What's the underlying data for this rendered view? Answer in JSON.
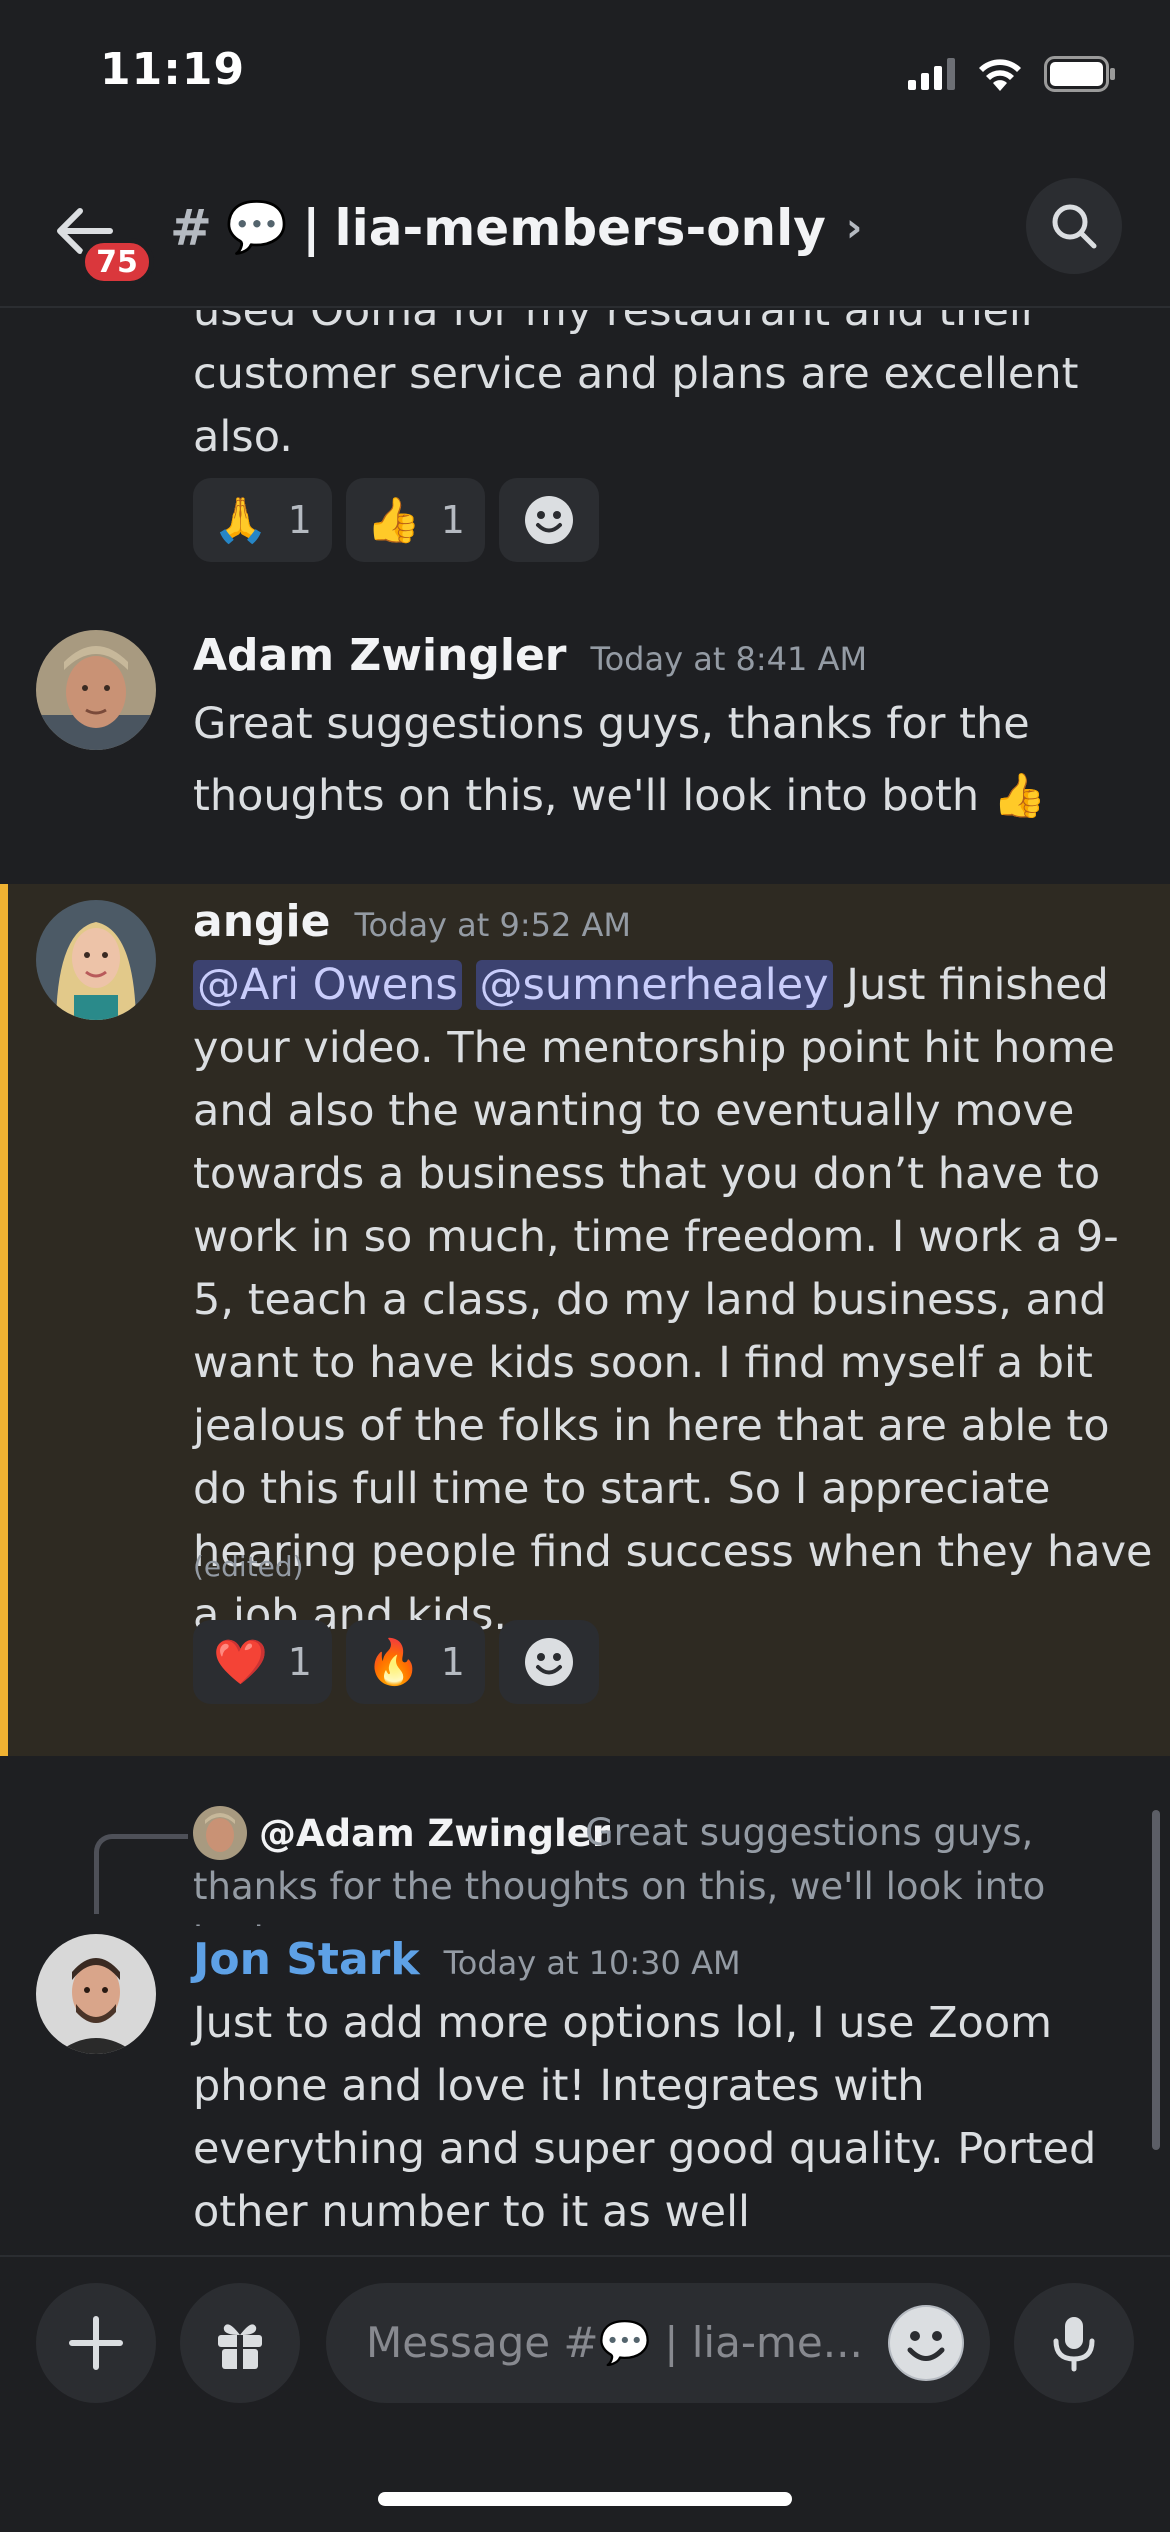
{
  "status_bar": {
    "time": "11:19"
  },
  "header": {
    "unread_badge": "75",
    "hash": "#",
    "channel_emoji": "💬",
    "separator": "|",
    "channel_name": "lia-members-only",
    "chevron": "›"
  },
  "messages": [
    {
      "type": "continuation",
      "text": "used Ooma for my restaurant and their customer service and plans are excellent also.",
      "reactions": [
        {
          "emoji": "🙏",
          "count": "1"
        },
        {
          "emoji": "👍",
          "count": "1"
        }
      ]
    },
    {
      "author": "Adam Zwingler",
      "timestamp": "Today at 8:41 AM",
      "text": "Great suggestions guys, thanks for the thoughts on this, we'll look into both 👍"
    },
    {
      "author": "angie",
      "timestamp": "Today at 9:52 AM",
      "mentions": [
        "@Ari Owens",
        "@sumnerhealey"
      ],
      "text": " Just finished your video. The mentorship point hit home and also the wanting to eventually move towards a business that you don’t have to work in so much, time freedom. I work a 9-5, teach a class, do my land business, and want to have kids soon. I find myself a bit jealous of the folks in here that are able to do this full time to start.  So I appreciate hearing people find success when they have a job and kids.",
      "edited": "(edited)",
      "reactions": [
        {
          "emoji": "❤️",
          "count": "1"
        },
        {
          "emoji": "🔥",
          "count": "1"
        }
      ]
    },
    {
      "reply_to": {
        "author": "@Adam Zwingler",
        "text": "Great suggestions guys, thanks for the thoughts on this, we'll look into both..."
      },
      "author": "Jon Stark",
      "author_color": "#5ea1e6",
      "timestamp": "Today at 10:30 AM",
      "text": "Just to add more options lol, I use Zoom phone and love it! Integrates with everything and super good quality. Ported other number to it as well"
    }
  ],
  "composer": {
    "placeholder": "Message #💬 | lia-me..."
  },
  "colors": {
    "background": "#1e1f22",
    "highlight": "#f0b232",
    "mention_bg": "#3c4270",
    "badge": "#da373c"
  },
  "icons": [
    "back-arrow-icon",
    "search-icon",
    "plus-icon",
    "gift-icon",
    "emoji-icon",
    "microphone-icon",
    "signal-icon",
    "wifi-icon",
    "battery-icon"
  ]
}
